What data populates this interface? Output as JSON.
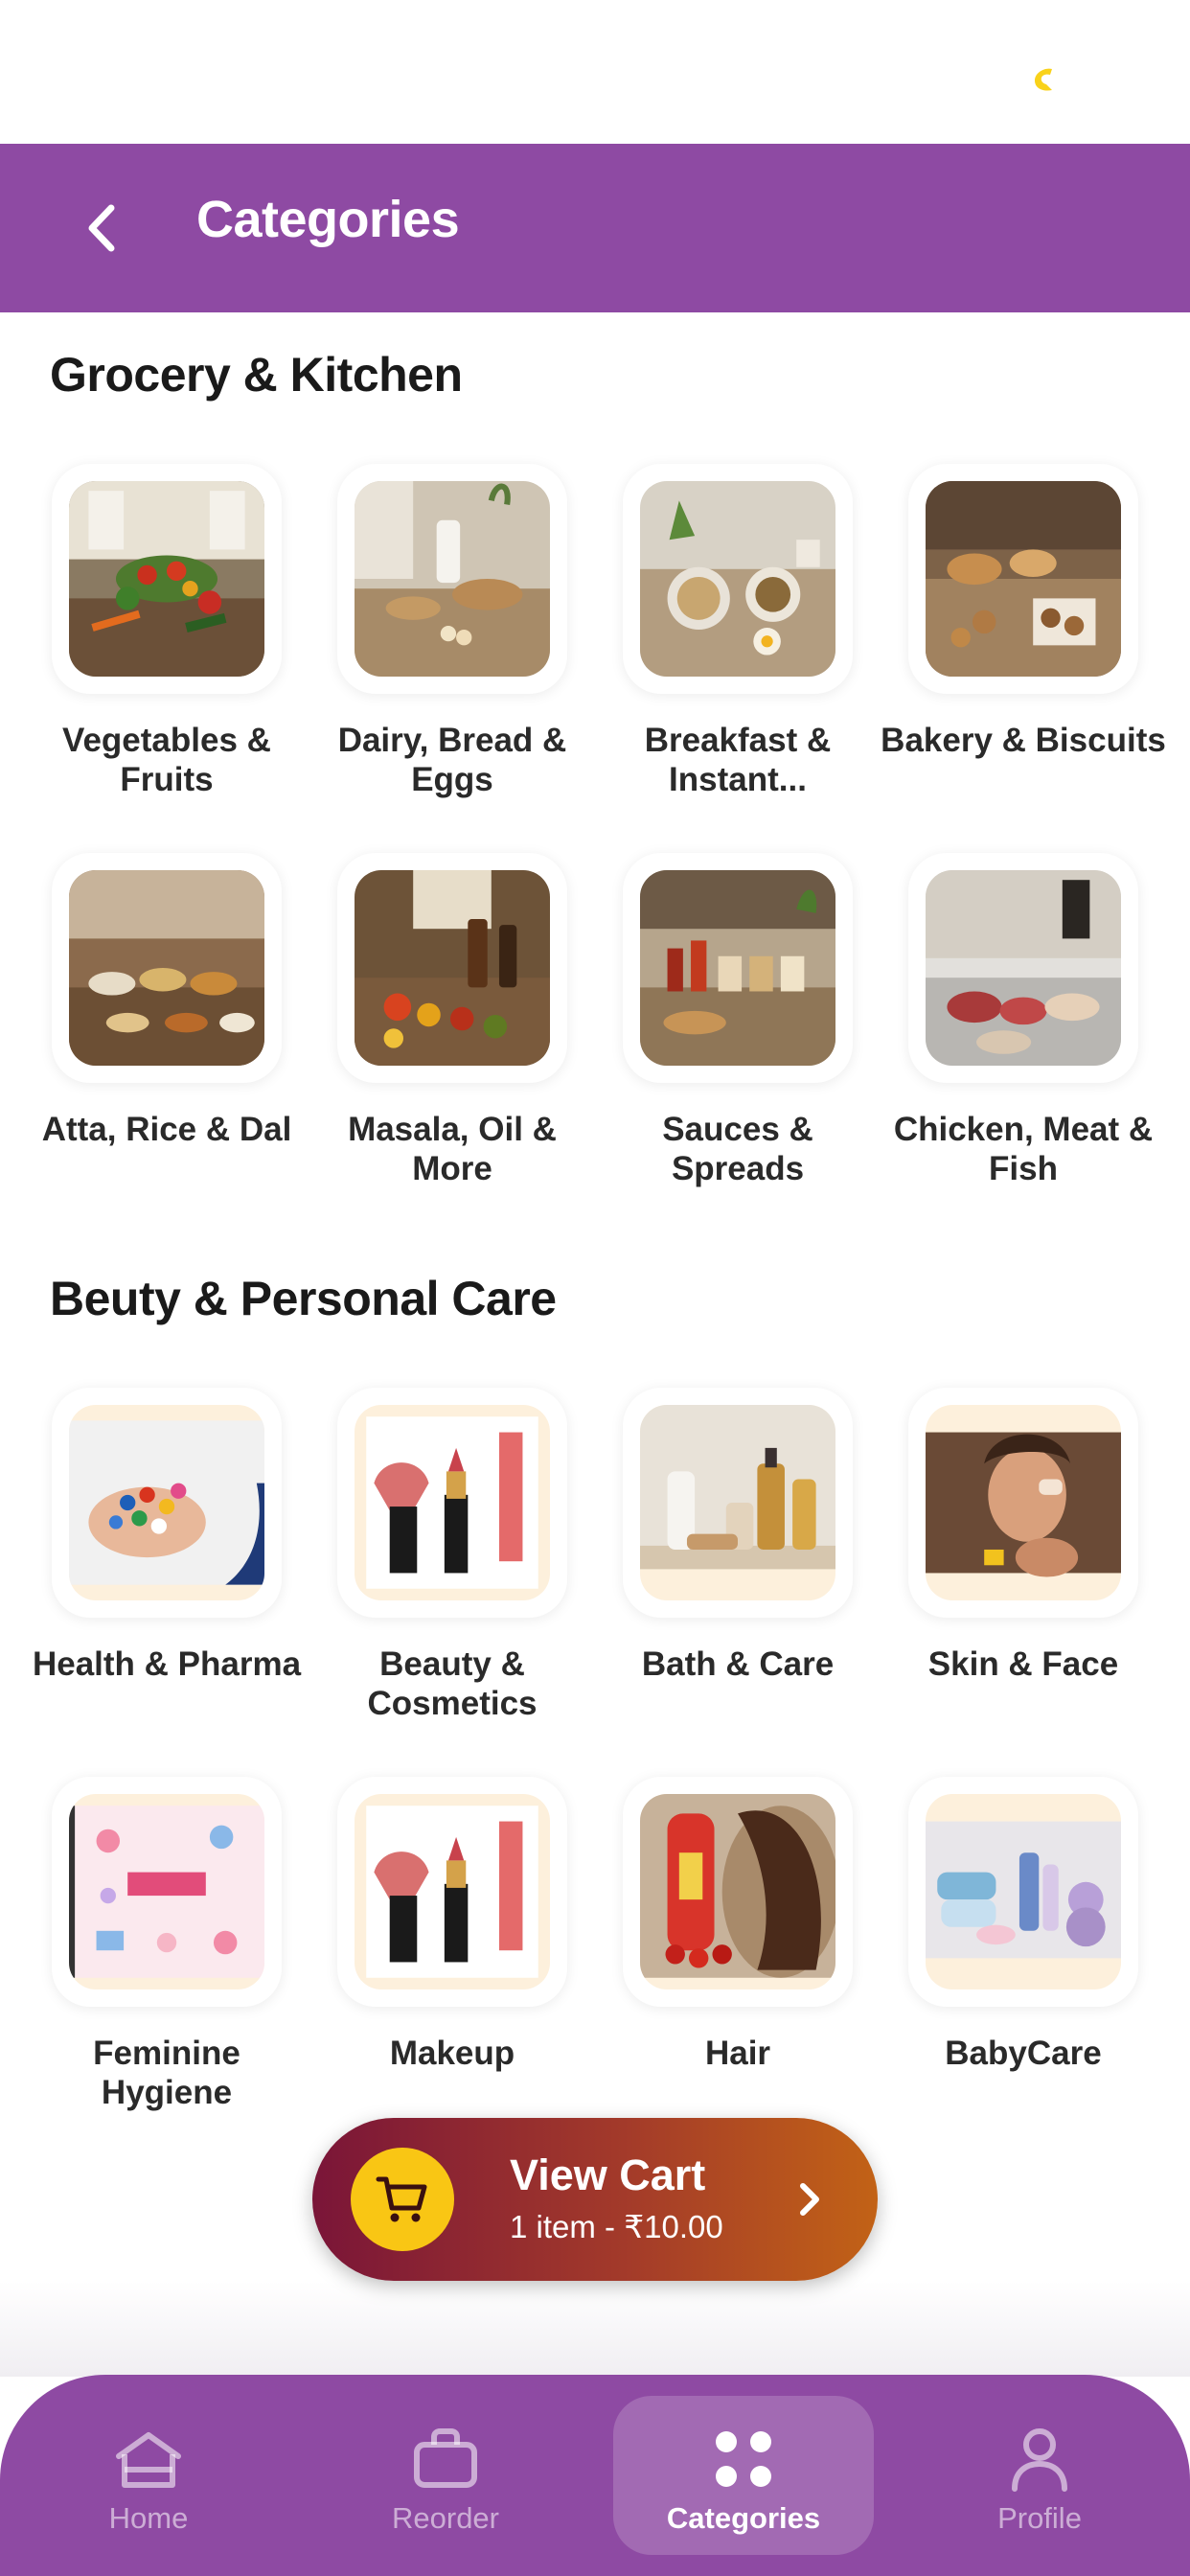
{
  "header": {
    "title": "Categories"
  },
  "sections": [
    {
      "title": "Grocery & Kitchen",
      "items": [
        {
          "label": "Vegetables & Fruits"
        },
        {
          "label": "Dairy, Bread & Eggs"
        },
        {
          "label": "Breakfast & Instant..."
        },
        {
          "label": "Bakery & Biscuits"
        },
        {
          "label": "Atta, Rice & Dal"
        },
        {
          "label": "Masala, Oil & More"
        },
        {
          "label": "Sauces & Spreads"
        },
        {
          "label": "Chicken, Meat & Fish"
        }
      ]
    },
    {
      "title": "Beuty & Personal Care",
      "items": [
        {
          "label": "Health & Pharma"
        },
        {
          "label": "Beauty & Cosmetics"
        },
        {
          "label": "Bath & Care"
        },
        {
          "label": "Skin & Face"
        },
        {
          "label": "Feminine Hygiene"
        },
        {
          "label": "Makeup"
        },
        {
          "label": "Hair"
        },
        {
          "label": "BabyCare"
        }
      ]
    }
  ],
  "cart": {
    "title": "View Cart",
    "summary": "1 item - ₹10.00"
  },
  "nav": {
    "items": [
      {
        "label": "Home",
        "icon": "home-icon"
      },
      {
        "label": "Reorder",
        "icon": "bag-icon"
      },
      {
        "label": "Categories",
        "icon": "categories-icon",
        "active": true
      },
      {
        "label": "Profile",
        "icon": "profile-icon"
      }
    ]
  },
  "colors": {
    "primary": "#8e4aa3",
    "cart_icon_bg": "#f9c614",
    "status_dot": "#f9d21a"
  }
}
